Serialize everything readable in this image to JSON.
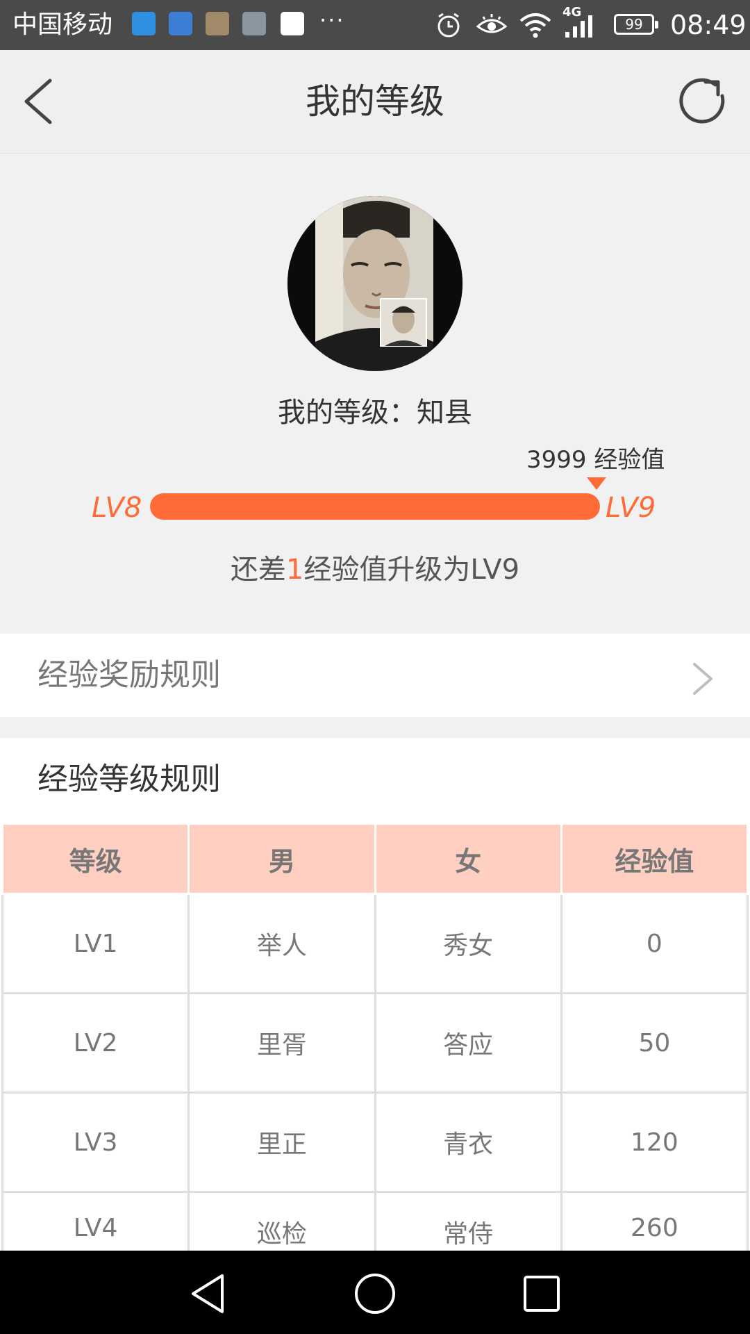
{
  "status_bar": {
    "carrier": "中国移动",
    "network": "4G",
    "battery": "99",
    "time": "08:49"
  },
  "header": {
    "title": "我的等级",
    "back_icon": "chevron-left-icon",
    "refresh_icon": "refresh-icon"
  },
  "profile": {
    "level_title": "我的等级：知县",
    "experience_label": "3999 经验值",
    "current_level": "LV8",
    "next_level": "LV9",
    "progress": 0.9998,
    "hint_prefix": "还差",
    "hint_amount": "1",
    "hint_suffix": "经验值升级为LV9"
  },
  "reward_rules": {
    "label": "经验奖励规则"
  },
  "level_rules": {
    "title": "经验等级规则",
    "headers": [
      "等级",
      "男",
      "女",
      "经验值"
    ],
    "rows": [
      [
        "LV1",
        "举人",
        "秀女",
        "0"
      ],
      [
        "LV2",
        "里胥",
        "答应",
        "50"
      ],
      [
        "LV3",
        "里正",
        "青衣",
        "120"
      ],
      [
        "LV4",
        "巡检",
        "常侍",
        "260"
      ]
    ]
  },
  "colors": {
    "accent": "#ff6a36",
    "table_header": "#ffd0c1"
  }
}
